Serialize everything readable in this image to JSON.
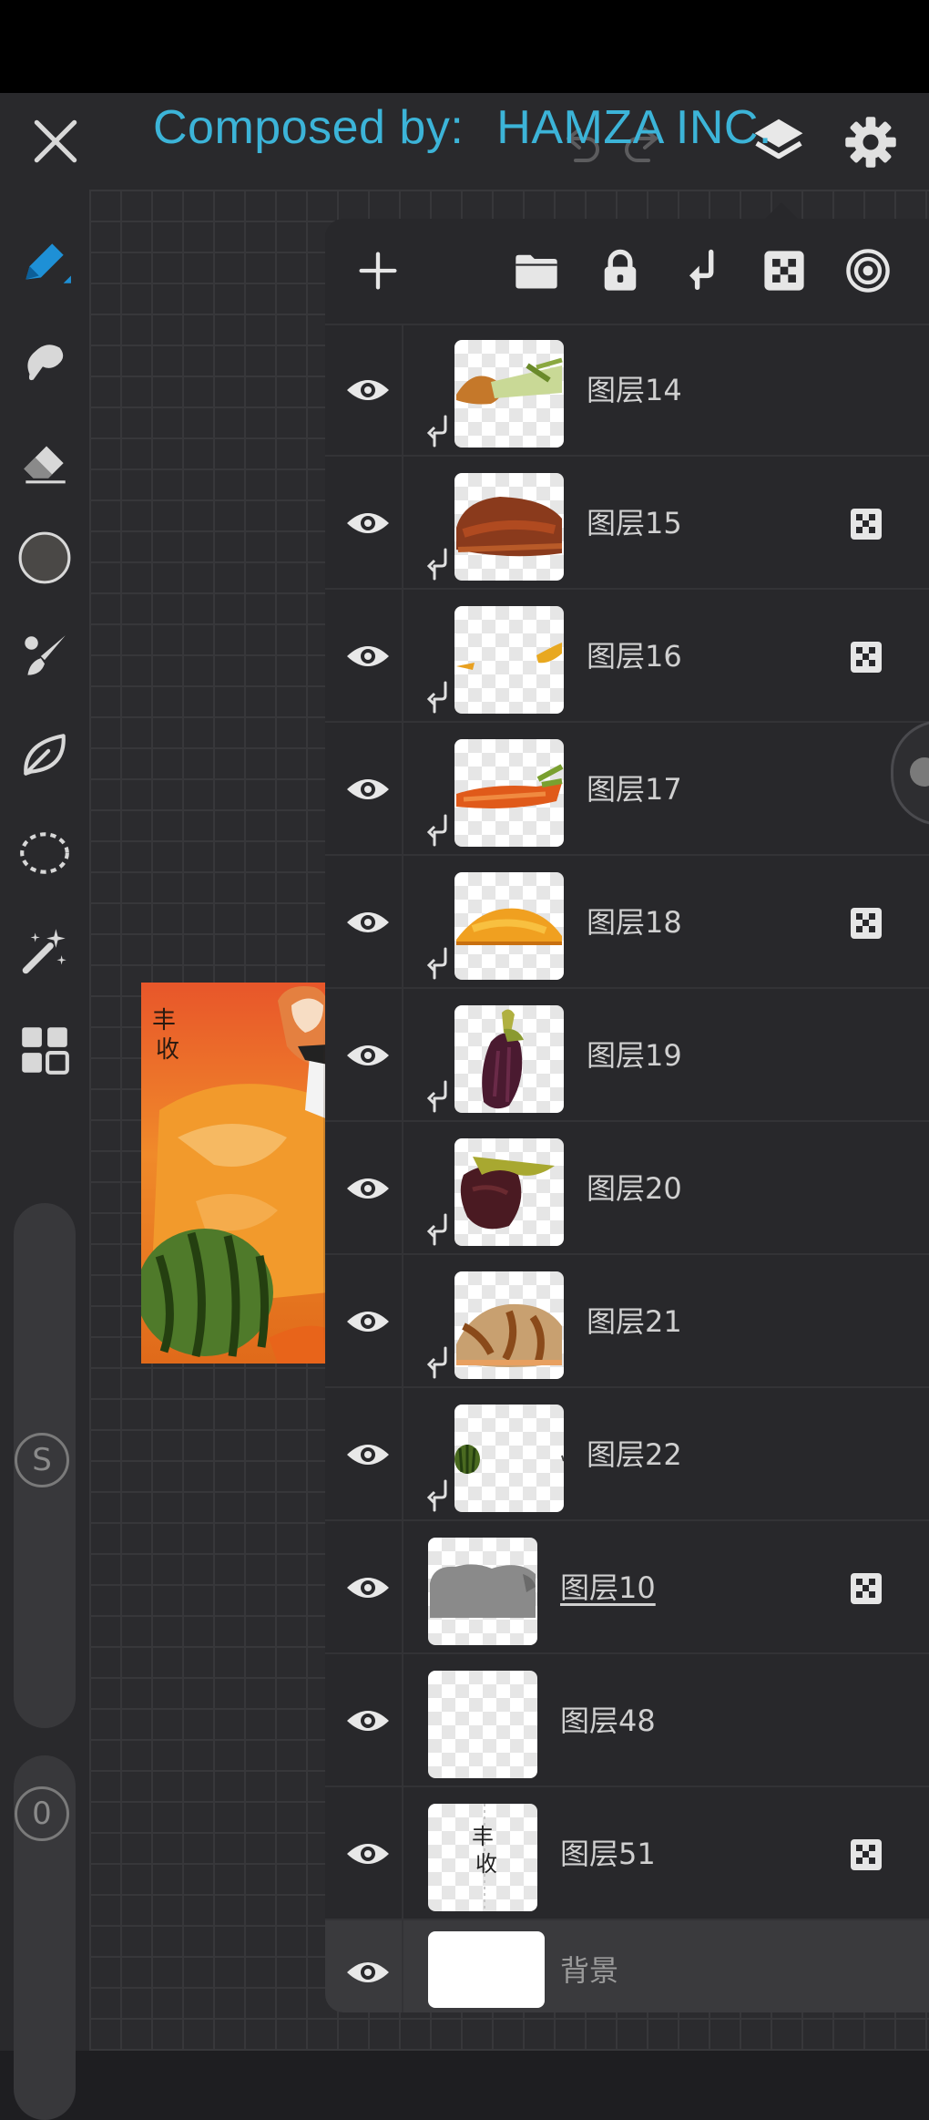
{
  "watermark": {
    "prefix": "Composed by:",
    "name": "HAMZA INC."
  },
  "header": {
    "close_icon": "close-icon",
    "undo_icon": "undo-icon",
    "redo_icon": "redo-icon",
    "layers_icon": "layers-icon",
    "settings_icon": "gear-icon"
  },
  "tools": [
    {
      "name": "brush",
      "icon": "pen-icon",
      "active": true
    },
    {
      "name": "smudge",
      "icon": "smudge-icon"
    },
    {
      "name": "eraser",
      "icon": "eraser-icon"
    },
    {
      "name": "color",
      "icon": "color-swatch",
      "color": "#4a4846"
    },
    {
      "name": "brush-library",
      "icon": "brush-library-icon"
    },
    {
      "name": "liquify",
      "icon": "leaf-icon"
    },
    {
      "name": "selection",
      "icon": "lasso-icon"
    },
    {
      "name": "magic-wand",
      "icon": "magic-wand-icon"
    },
    {
      "name": "gallery",
      "icon": "grid-icon"
    }
  ],
  "size_slider": {
    "label": "S"
  },
  "opacity_slider": {
    "label": "0"
  },
  "layer_toolbar": [
    "add-icon",
    "folder-icon",
    "lock-icon",
    "clip-icon",
    "alpha-lock-icon",
    "blend-mode-icon"
  ],
  "layers": [
    {
      "name": "图层14",
      "clipped": true,
      "alpha_locked": false
    },
    {
      "name": "图层15",
      "clipped": true,
      "alpha_locked": true
    },
    {
      "name": "图层16",
      "clipped": true,
      "alpha_locked": true
    },
    {
      "name": "图层17",
      "clipped": true,
      "alpha_locked": false
    },
    {
      "name": "图层18",
      "clipped": true,
      "alpha_locked": true
    },
    {
      "name": "图层19",
      "clipped": true,
      "alpha_locked": false
    },
    {
      "name": "图层20",
      "clipped": true,
      "alpha_locked": false
    },
    {
      "name": "图层21",
      "clipped": true,
      "alpha_locked": false
    },
    {
      "name": "图层22",
      "clipped": true,
      "alpha_locked": false
    },
    {
      "name": "图层10",
      "clipped": false,
      "alpha_locked": true,
      "selected": true
    },
    {
      "name": "图层48",
      "clipped": false,
      "alpha_locked": false
    },
    {
      "name": "图层51",
      "clipped": false,
      "alpha_locked": true
    },
    {
      "name": "背景",
      "clipped": false,
      "alpha_locked": false,
      "background": true
    }
  ],
  "colors": {
    "accent": "#1e90d6",
    "watermark": "#3cb4d8",
    "panel": "#28282b"
  }
}
